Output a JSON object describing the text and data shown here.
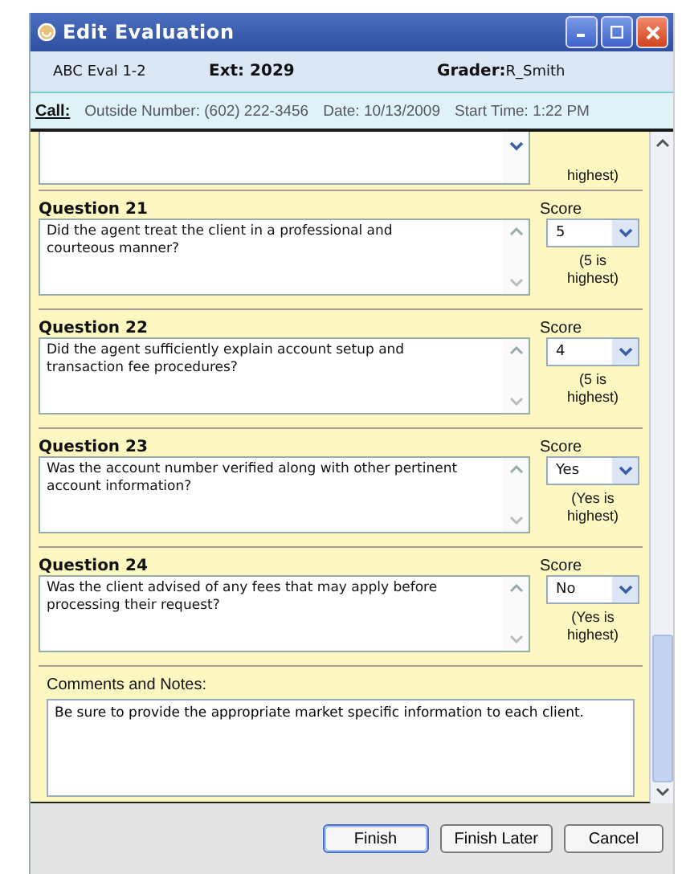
{
  "window": {
    "title": "Edit Evaluation"
  },
  "info": {
    "evaluation": "ABC Eval 1-2",
    "extension": "Ext: 2029",
    "grader_label": "Grader:",
    "grader": "R_Smith"
  },
  "call": {
    "label": "Call:",
    "outside_number": "Outside Number: (602) 222-3456",
    "date": "Date: 10/13/2009",
    "start_time": "Start Time: 1:22 PM"
  },
  "partial_question": {
    "score_note": "highest)"
  },
  "questions": [
    {
      "title": "Question 21",
      "text": "Did the agent treat the client in a professional and courteous manner?",
      "score_label": "Score",
      "score": "5",
      "score_note": "(5 is highest)"
    },
    {
      "title": "Question 22",
      "text": "Did the agent sufficiently explain account setup and transaction fee procedures?",
      "score_label": "Score",
      "score": "4",
      "score_note": "(5 is highest)"
    },
    {
      "title": "Question 23",
      "text": "Was the account number verified along with other pertinent account information?",
      "score_label": "Score",
      "score": "Yes",
      "score_note": "(Yes is highest)"
    },
    {
      "title": "Question 24",
      "text": "Was the client advised of any fees that may apply before processing their request?",
      "score_label": "Score",
      "score": "No",
      "score_note": "(Yes is highest)"
    }
  ],
  "comments": {
    "label": "Comments and Notes:",
    "value": "Be sure to provide the appropriate market specific information to each client."
  },
  "buttons": [
    "Finish",
    "Finish Later",
    "Cancel"
  ]
}
